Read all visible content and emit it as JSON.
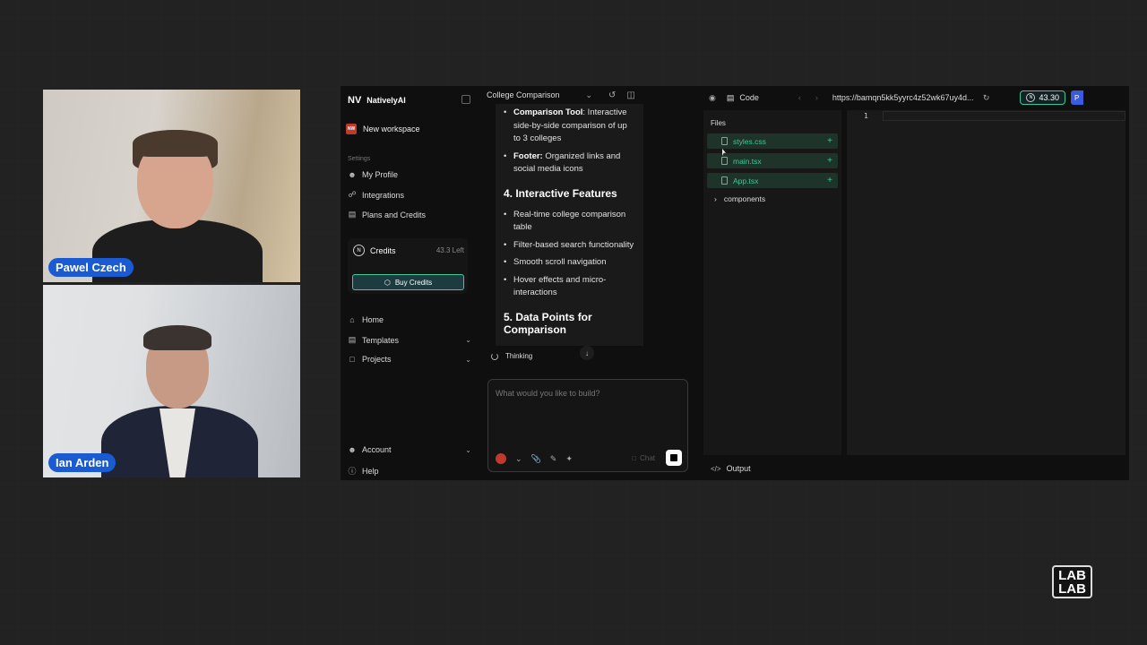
{
  "participants": [
    {
      "name": "Pawel Czech"
    },
    {
      "name": "Ian Arden"
    }
  ],
  "sidebar": {
    "brand": "NativelyAI",
    "brand_logo": "NV",
    "workspace_badge": "NW",
    "workspace": "New workspace",
    "settings_heading": "Settings",
    "settings_items": [
      {
        "label": "My Profile",
        "icon": "user-icon"
      },
      {
        "label": "Integrations",
        "icon": "integrations-icon"
      },
      {
        "label": "Plans and Credits",
        "icon": "card-icon"
      }
    ],
    "credits": {
      "label": "Credits",
      "remaining": "43.3 Left",
      "buy_label": "Buy Credits"
    },
    "nav_items": [
      {
        "label": "Home",
        "icon": "home-icon"
      },
      {
        "label": "Templates",
        "icon": "templates-icon"
      },
      {
        "label": "Projects",
        "icon": "folder-icon"
      }
    ],
    "bottom_items": [
      {
        "label": "Account",
        "icon": "account-icon"
      },
      {
        "label": "Help",
        "icon": "help-icon"
      }
    ]
  },
  "chat": {
    "project_title": "College Comparison",
    "messages": {
      "b1_bold": "Comparison Tool",
      "b1_text": ": Interactive side-by-side comparison of up to 3 colleges",
      "b2_bold": "Footer:",
      "b2_text": " Organized links and social media icons",
      "sec4": "4. Interactive Features",
      "f1": "Real-time college comparison table",
      "f2": "Filter-based search functionality",
      "f3": "Smooth scroll navigation",
      "f4": "Hover effects and micro-interactions",
      "sec5": "5. Data Points for Comparison"
    },
    "status": "Thinking",
    "input_placeholder": "What would you like to build?",
    "chat_label": "Chat"
  },
  "editor": {
    "tab_label": "Code",
    "url": "https://bamqn5kk5yyrc4z52wk67uy4d...",
    "credits_score": "43.30",
    "files_heading": "Files",
    "files": [
      "styles.css",
      "main.tsx",
      "App.tsx"
    ],
    "folders": [
      "components"
    ],
    "line_number": "1",
    "output_label": "Output"
  },
  "watermark": {
    "line1": "LAB",
    "line2": "LAB"
  },
  "colors": {
    "accent": "#3ec99a",
    "name_tag": "#1a5bd1",
    "background": "#141414"
  }
}
